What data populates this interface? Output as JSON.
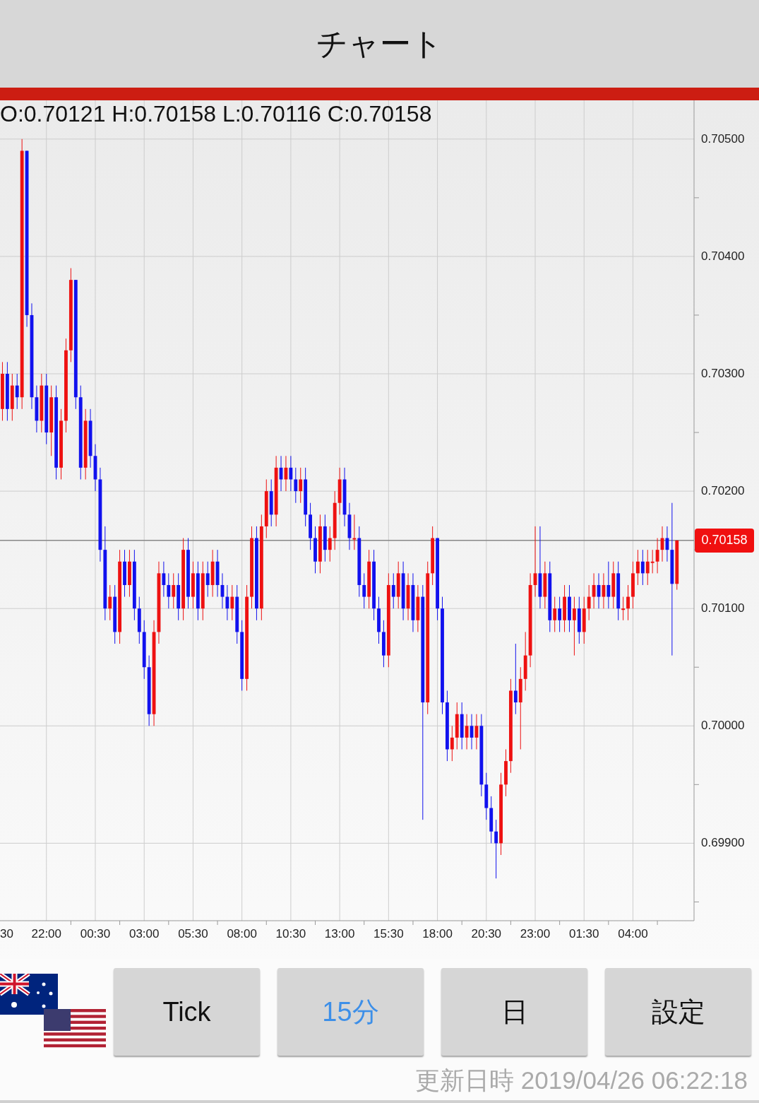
{
  "header": {
    "title": "チャート"
  },
  "chart": {
    "ohlc_readout": "O:0.70121 H:0.70158 L:0.70116 C:0.70158",
    "cut_x_label": "30",
    "chart_data": {
      "type": "candlestick",
      "ylim": [
        0.69834,
        0.70533
      ],
      "grid": true,
      "ref_lines": [
        {
          "axis": "y",
          "value": 0.70158,
          "label": "0.70158"
        }
      ],
      "yticks": [
        {
          "value": 0.705,
          "label": "0.70500"
        },
        {
          "value": 0.704,
          "label": "0.70400"
        },
        {
          "value": 0.703,
          "label": "0.70300"
        },
        {
          "value": 0.702,
          "label": "0.70200"
        },
        {
          "value": 0.701,
          "label": "0.70100"
        },
        {
          "value": 0.7,
          "label": "0.70000"
        },
        {
          "value": 0.699,
          "label": "0.69900"
        }
      ],
      "categories": [
        null,
        null,
        null,
        null,
        null,
        null,
        null,
        null,
        null,
        "22:00",
        null,
        null,
        null,
        null,
        null,
        null,
        null,
        null,
        null,
        "00:30",
        null,
        null,
        null,
        null,
        null,
        null,
        null,
        null,
        null,
        "03:00",
        null,
        null,
        null,
        null,
        null,
        null,
        null,
        null,
        null,
        "05:30",
        null,
        null,
        null,
        null,
        null,
        null,
        null,
        null,
        null,
        "08:00",
        null,
        null,
        null,
        null,
        null,
        null,
        null,
        null,
        null,
        "10:30",
        null,
        null,
        null,
        null,
        null,
        null,
        null,
        null,
        null,
        "13:00",
        null,
        null,
        null,
        null,
        null,
        null,
        null,
        null,
        null,
        "15:30",
        null,
        null,
        null,
        null,
        null,
        null,
        null,
        null,
        null,
        "18:00",
        null,
        null,
        null,
        null,
        null,
        null,
        null,
        null,
        null,
        "20:30",
        null,
        null,
        null,
        null,
        null,
        null,
        null,
        null,
        null,
        "23:00",
        null,
        null,
        null,
        null,
        null,
        null,
        null,
        null,
        null,
        "01:30",
        null,
        null,
        null,
        null,
        null,
        null,
        null,
        null,
        null,
        "04:00",
        null,
        null,
        null,
        null,
        null,
        null,
        null,
        null,
        null,
        null,
        null,
        null
      ],
      "ohlc": [
        [
          0.7027,
          0.7031,
          0.7026,
          0.703
        ],
        [
          0.703,
          0.7031,
          0.7026,
          0.7027
        ],
        [
          0.7027,
          0.703,
          0.7026,
          0.7029
        ],
        [
          0.7029,
          0.703,
          0.7027,
          0.7028
        ],
        [
          0.7028,
          0.705,
          0.7027,
          0.7049
        ],
        [
          0.7049,
          0.7049,
          0.7034,
          0.7035
        ],
        [
          0.7035,
          0.7036,
          0.7027,
          0.7028
        ],
        [
          0.7028,
          0.7029,
          0.7025,
          0.7026
        ],
        [
          0.7026,
          0.703,
          0.7025,
          0.7029
        ],
        [
          0.7029,
          0.703,
          0.7024,
          0.7025
        ],
        [
          0.7025,
          0.7029,
          0.7023,
          0.7028
        ],
        [
          0.7028,
          0.7029,
          0.7021,
          0.7022
        ],
        [
          0.7022,
          0.7027,
          0.7021,
          0.7026
        ],
        [
          0.7026,
          0.7033,
          0.7025,
          0.7032
        ],
        [
          0.7032,
          0.7039,
          0.7031,
          0.7038
        ],
        [
          0.7038,
          0.7038,
          0.7027,
          0.7028
        ],
        [
          0.7028,
          0.7029,
          0.7021,
          0.7022
        ],
        [
          0.7022,
          0.7027,
          0.7021,
          0.7026
        ],
        [
          0.7026,
          0.7027,
          0.7022,
          0.7023
        ],
        [
          0.7023,
          0.7024,
          0.702,
          0.7021
        ],
        [
          0.7021,
          0.7022,
          0.7014,
          0.7015
        ],
        [
          0.7015,
          0.7017,
          0.7009,
          0.701
        ],
        [
          0.701,
          0.7012,
          0.7009,
          0.7011
        ],
        [
          0.7011,
          0.7012,
          0.7007,
          0.7008
        ],
        [
          0.7008,
          0.7015,
          0.7007,
          0.7014
        ],
        [
          0.7014,
          0.7015,
          0.7011,
          0.7012
        ],
        [
          0.7012,
          0.7015,
          0.7011,
          0.7014
        ],
        [
          0.7014,
          0.7015,
          0.7009,
          0.701
        ],
        [
          0.701,
          0.7011,
          0.7007,
          0.7008
        ],
        [
          0.7008,
          0.7009,
          0.7004,
          0.7005
        ],
        [
          0.7005,
          0.7006,
          0.7,
          0.7001
        ],
        [
          0.7001,
          0.7009,
          0.7,
          0.7008
        ],
        [
          0.7008,
          0.7014,
          0.7007,
          0.7013
        ],
        [
          0.7013,
          0.7014,
          0.7011,
          0.7012
        ],
        [
          0.7012,
          0.7013,
          0.701,
          0.7011
        ],
        [
          0.7011,
          0.7013,
          0.701,
          0.7012
        ],
        [
          0.7012,
          0.7013,
          0.7009,
          0.701
        ],
        [
          0.701,
          0.7016,
          0.7009,
          0.7015
        ],
        [
          0.7015,
          0.7016,
          0.701,
          0.7011
        ],
        [
          0.7011,
          0.7014,
          0.701,
          0.7013
        ],
        [
          0.7013,
          0.7014,
          0.7009,
          0.701
        ],
        [
          0.701,
          0.7014,
          0.7009,
          0.7013
        ],
        [
          0.7013,
          0.7014,
          0.7011,
          0.7012
        ],
        [
          0.7012,
          0.7015,
          0.7011,
          0.7014
        ],
        [
          0.7014,
          0.7015,
          0.7011,
          0.7012
        ],
        [
          0.7012,
          0.7013,
          0.701,
          0.7011
        ],
        [
          0.7011,
          0.7012,
          0.7009,
          0.701
        ],
        [
          0.701,
          0.7012,
          0.7009,
          0.7011
        ],
        [
          0.7011,
          0.7012,
          0.7007,
          0.7008
        ],
        [
          0.7008,
          0.7009,
          0.7003,
          0.7004
        ],
        [
          0.7004,
          0.7012,
          0.7003,
          0.7011
        ],
        [
          0.7011,
          0.7017,
          0.701,
          0.7016
        ],
        [
          0.7016,
          0.7017,
          0.7009,
          0.701
        ],
        [
          0.701,
          0.7018,
          0.7009,
          0.7017
        ],
        [
          0.7017,
          0.7021,
          0.7016,
          0.702
        ],
        [
          0.702,
          0.7021,
          0.7017,
          0.7018
        ],
        [
          0.7018,
          0.7023,
          0.7017,
          0.7022
        ],
        [
          0.7022,
          0.7023,
          0.702,
          0.7021
        ],
        [
          0.7021,
          0.7023,
          0.702,
          0.7022
        ],
        [
          0.7022,
          0.7023,
          0.702,
          0.7021
        ],
        [
          0.7021,
          0.7022,
          0.7019,
          0.702
        ],
        [
          0.702,
          0.7022,
          0.7019,
          0.7021
        ],
        [
          0.7021,
          0.7022,
          0.7017,
          0.7018
        ],
        [
          0.7018,
          0.7019,
          0.7015,
          0.7016
        ],
        [
          0.7016,
          0.7017,
          0.7013,
          0.7014
        ],
        [
          0.7014,
          0.7018,
          0.7013,
          0.7017
        ],
        [
          0.7017,
          0.7018,
          0.7014,
          0.7015
        ],
        [
          0.7015,
          0.7017,
          0.7014,
          0.7016
        ],
        [
          0.7016,
          0.702,
          0.7015,
          0.7019
        ],
        [
          0.7019,
          0.7022,
          0.7018,
          0.7021
        ],
        [
          0.7021,
          0.7022,
          0.7017,
          0.7018
        ],
        [
          0.7018,
          0.7019,
          0.7015,
          0.7016
        ],
        [
          0.7016,
          0.7018,
          0.7015,
          0.7016
        ],
        [
          0.7016,
          0.7017,
          0.7011,
          0.7012
        ],
        [
          0.7012,
          0.7013,
          0.701,
          0.7011
        ],
        [
          0.7011,
          0.7015,
          0.701,
          0.7014
        ],
        [
          0.7014,
          0.7015,
          0.7009,
          0.701
        ],
        [
          0.701,
          0.7011,
          0.7007,
          0.7008
        ],
        [
          0.7008,
          0.7009,
          0.7005,
          0.7006
        ],
        [
          0.7006,
          0.7013,
          0.7005,
          0.7012
        ],
        [
          0.7012,
          0.7013,
          0.701,
          0.7011
        ],
        [
          0.7011,
          0.7014,
          0.701,
          0.7013
        ],
        [
          0.7013,
          0.7014,
          0.7009,
          0.701
        ],
        [
          0.701,
          0.7013,
          0.7009,
          0.7012
        ],
        [
          0.7012,
          0.7013,
          0.7008,
          0.7009
        ],
        [
          0.7009,
          0.7012,
          0.7008,
          0.7011
        ],
        [
          0.7011,
          0.7012,
          0.6992,
          0.7002
        ],
        [
          0.7002,
          0.7014,
          0.7001,
          0.7013
        ],
        [
          0.7013,
          0.7017,
          0.7012,
          0.7016
        ],
        [
          0.7016,
          0.7016,
          0.7009,
          0.701
        ],
        [
          0.701,
          0.7011,
          0.7001,
          0.7002
        ],
        [
          0.7002,
          0.7003,
          0.6997,
          0.6998
        ],
        [
          0.6998,
          0.7,
          0.6997,
          0.6999
        ],
        [
          0.6999,
          0.7002,
          0.6998,
          0.7001
        ],
        [
          0.7001,
          0.7002,
          0.6998,
          0.6999
        ],
        [
          0.6999,
          0.7001,
          0.6998,
          0.7
        ],
        [
          0.7,
          0.7001,
          0.6998,
          0.6999
        ],
        [
          0.6999,
          0.7001,
          0.6998,
          0.7
        ],
        [
          0.7,
          0.7001,
          0.6994,
          0.6995
        ],
        [
          0.6995,
          0.6996,
          0.6992,
          0.6993
        ],
        [
          0.6993,
          0.6994,
          0.699,
          0.6991
        ],
        [
          0.6991,
          0.6992,
          0.6987,
          0.699
        ],
        [
          0.699,
          0.6996,
          0.6989,
          0.6995
        ],
        [
          0.6995,
          0.6998,
          0.6994,
          0.6997
        ],
        [
          0.6997,
          0.7004,
          0.6996,
          0.7003
        ],
        [
          0.7003,
          0.7007,
          0.7001,
          0.7002
        ],
        [
          0.7002,
          0.7005,
          0.6998,
          0.7004
        ],
        [
          0.7004,
          0.7008,
          0.7003,
          0.7006
        ],
        [
          0.7006,
          0.7013,
          0.7005,
          0.7012
        ],
        [
          0.7012,
          0.7017,
          0.7011,
          0.7013
        ],
        [
          0.7013,
          0.7017,
          0.701,
          0.7011
        ],
        [
          0.7011,
          0.7014,
          0.701,
          0.7013
        ],
        [
          0.7013,
          0.7014,
          0.7008,
          0.7009
        ],
        [
          0.7009,
          0.7011,
          0.7008,
          0.701
        ],
        [
          0.701,
          0.7011,
          0.7008,
          0.7009
        ],
        [
          0.7009,
          0.7012,
          0.7008,
          0.7011
        ],
        [
          0.7011,
          0.7012,
          0.7008,
          0.7009
        ],
        [
          0.7009,
          0.7011,
          0.7006,
          0.701
        ],
        [
          0.701,
          0.7011,
          0.7007,
          0.7008
        ],
        [
          0.7008,
          0.7011,
          0.7007,
          0.701
        ],
        [
          0.701,
          0.7012,
          0.7009,
          0.7011
        ],
        [
          0.7011,
          0.7013,
          0.701,
          0.7012
        ],
        [
          0.7012,
          0.7013,
          0.701,
          0.7011
        ],
        [
          0.7011,
          0.7013,
          0.701,
          0.7012
        ],
        [
          0.7012,
          0.7014,
          0.701,
          0.7011
        ],
        [
          0.7011,
          0.7014,
          0.701,
          0.7013
        ],
        [
          0.7013,
          0.7014,
          0.7009,
          0.701
        ],
        [
          0.701,
          0.7011,
          0.7009,
          0.701
        ],
        [
          0.701,
          0.7012,
          0.7009,
          0.7011
        ],
        [
          0.7011,
          0.7014,
          0.701,
          0.7013
        ],
        [
          0.7013,
          0.7015,
          0.7012,
          0.7014
        ],
        [
          0.7014,
          0.7015,
          0.7012,
          0.7013
        ],
        [
          0.7013,
          0.7015,
          0.7012,
          0.7014
        ],
        [
          0.7014,
          0.7015,
          0.7013,
          0.7014
        ],
        [
          0.7014,
          0.7016,
          0.7013,
          0.7015
        ],
        [
          0.7015,
          0.7017,
          0.7014,
          0.7016
        ],
        [
          0.7016,
          0.7017,
          0.7014,
          0.7015
        ],
        [
          0.7015,
          0.7019,
          0.7006,
          0.70121
        ],
        [
          0.70121,
          0.70158,
          0.70116,
          0.70158
        ],
        null,
        null,
        null
      ]
    }
  },
  "buttons": [
    {
      "label": "Tick",
      "selected": false
    },
    {
      "label": "15分",
      "selected": true
    },
    {
      "label": "日",
      "selected": false
    },
    {
      "label": "設定",
      "selected": false
    }
  ],
  "updated": "更新日時 2019/04/26 06:22:18"
}
